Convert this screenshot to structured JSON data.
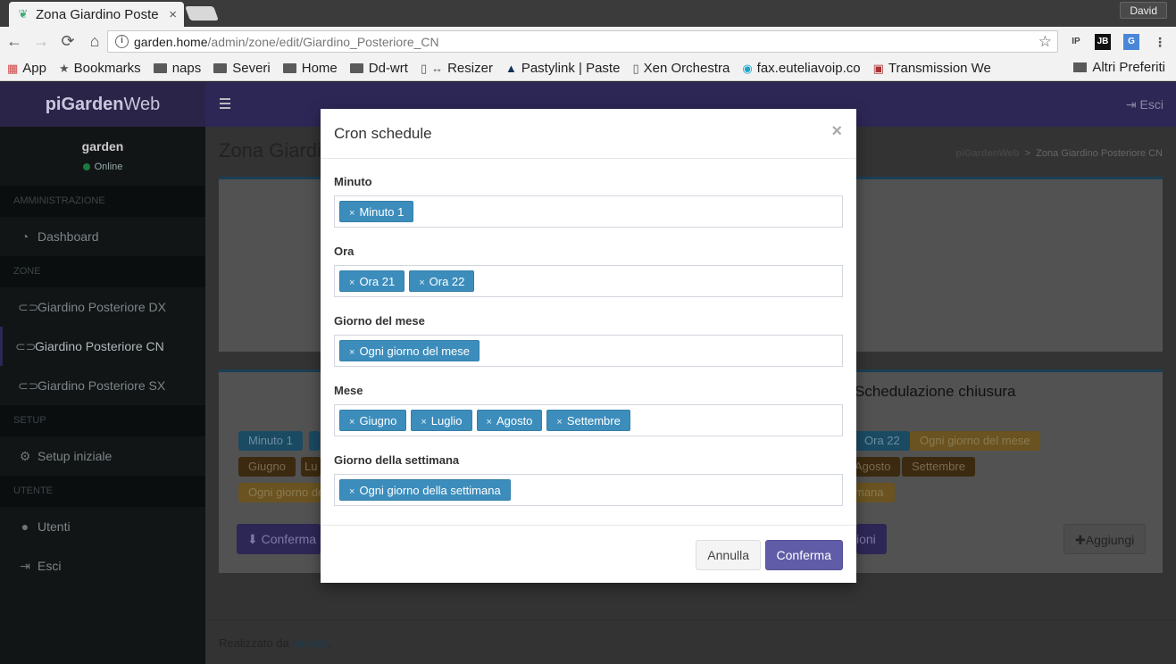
{
  "browser": {
    "tab_title": "Zona Giardino Poste",
    "user": "David",
    "url_host": "garden.home",
    "url_path": "/admin/zone/edit/Giardino_Posteriore_CN",
    "ext_icons": [
      "IP",
      "JB",
      "G"
    ],
    "bookmarks": [
      "App",
      "Bookmarks",
      "naps",
      "Severi",
      "Home",
      "Dd-wrt",
      "Resizer",
      "Pastylink | Paste",
      "Xen Orchestra",
      "fax.euteliavoip.co",
      "Transmission Wel"
    ],
    "other_bookmarks": "Altri Preferiti"
  },
  "app": {
    "logo_bold": "piGarden",
    "logo_rest": "Web",
    "logout": "Esci",
    "user_name": "garden",
    "user_status": "Online",
    "sections": {
      "admin": "AMMINISTRAZIONE",
      "zone": "ZONE",
      "setup": "SETUP",
      "utente": "UTENTE"
    },
    "items": {
      "dashboard": "Dashboard",
      "zone_dx": "Giardino Posteriore DX",
      "zone_cn": "Giardino Posteriore CN",
      "zone_sx": "Giardino Posteriore SX",
      "setup": "Setup iniziale",
      "utenti": "Utenti",
      "esci": "Esci"
    },
    "page_title": "Zona Giardi",
    "breadcrumb_root": "piGardenWeb",
    "breadcrumb_current": "Zona Giardino Posteriore CN",
    "close_schedule_title": "Schedulazione chiusura",
    "bg_chips": {
      "minuto": "Minuto 1",
      "ora22": "Ora 22",
      "ogni_giorno": "Ogni giorno del mese",
      "giugno": "Giugno",
      "lu": "Lu",
      "agosto": "Agosto",
      "settembre": "Settembre",
      "ogni_gi": "Ogni giorno de",
      "mana": "mana"
    },
    "confirm_partial": "Conferma s",
    "ioni_partial": "ioni",
    "add": "Aggiungi",
    "footer_text": "Realizzato da ",
    "footer_link": "lejubila",
    "footer_dot": "."
  },
  "modal": {
    "title": "Cron schedule",
    "close": "×",
    "fields": [
      {
        "label": "Minuto",
        "tags": [
          "Minuto 1"
        ]
      },
      {
        "label": "Ora",
        "tags": [
          "Ora 21",
          "Ora 22"
        ]
      },
      {
        "label": "Giorno del mese",
        "tags": [
          "Ogni giorno del mese"
        ]
      },
      {
        "label": "Mese",
        "tags": [
          "Giugno",
          "Luglio",
          "Agosto",
          "Settembre"
        ]
      },
      {
        "label": "Giorno della settimana",
        "tags": [
          "Ogni giorno della settimana"
        ]
      }
    ],
    "tag_remove": "×",
    "cancel": "Annulla",
    "confirm": "Conferma"
  }
}
